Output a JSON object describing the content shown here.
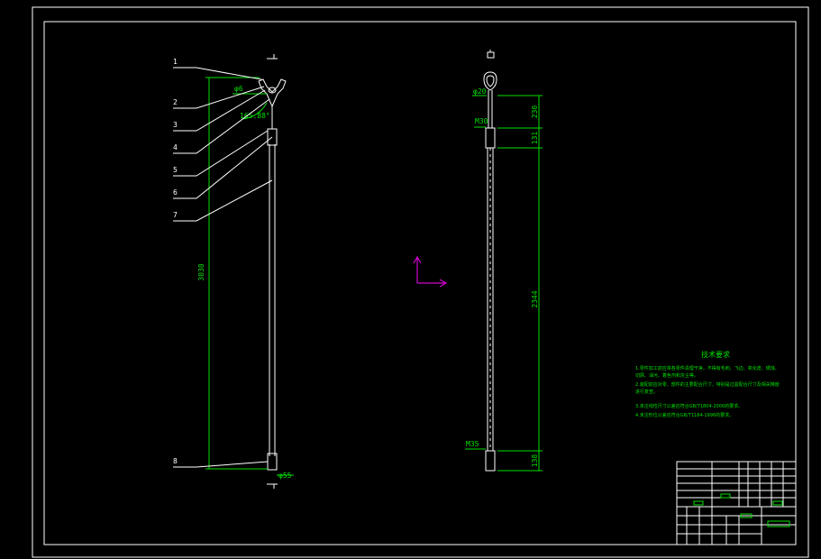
{
  "colors": {
    "background": "#000000",
    "frame": "#ffffff",
    "dimension": "#00e000",
    "ucs": "#d000d0"
  },
  "left_view": {
    "balloons": [
      "1",
      "2",
      "3",
      "4",
      "5",
      "6",
      "7",
      "8"
    ],
    "dims": {
      "top_dia": "φ6",
      "angle": "165.88°",
      "overall_height": "3030",
      "base_dia": "φ55"
    }
  },
  "right_view": {
    "dims": {
      "head_dia": "φ20",
      "collar": "M30",
      "bottom_thread": "M35",
      "seg_1": "230",
      "seg_2": "131",
      "seg_3": "2344",
      "seg_4": "138"
    }
  },
  "notes": {
    "title": "技术要求",
    "items": [
      "1.零件加工前应将各零件清理干净，不得有毛刺、飞边、氧化皮、锈蚀、",
      "  切屑、油污、着色剂和灰尘等。",
      "2.装配前应对零、部件的主要配合尺寸，特别是过盈配合尺寸及相关精度",
      "  进行复查。",
      "3.未注线性尺寸公差应符合GB/T1804-2000的要求。",
      "4.未注形位公差应符合GB/T1184-1996的要求。"
    ]
  }
}
